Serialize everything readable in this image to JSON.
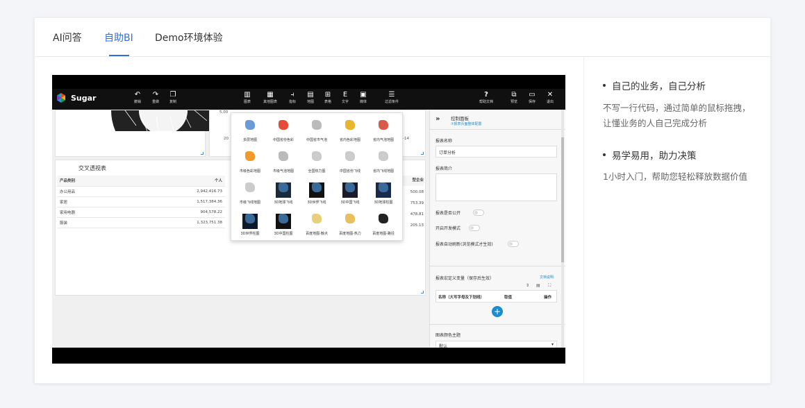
{
  "tabs": [
    {
      "label": "AI问答"
    },
    {
      "label": "自助BI"
    },
    {
      "label": "Demo环境体验"
    }
  ],
  "active_tab": 1,
  "side": {
    "items": [
      {
        "title": "自己的业务，自己分析",
        "desc_line1": "不写一行代码，通过简单的鼠标拖拽，",
        "desc_line2": "让懂业务的人自己完成分析"
      },
      {
        "title": "易学易用，助力决策",
        "desc_line1": "1小时入门，帮助您轻松释放数据价值",
        "desc_line2": ""
      }
    ]
  },
  "video": {
    "app_name": "Sugar",
    "toolbar_left": [
      {
        "icon": "undo-icon",
        "label": "撤销"
      },
      {
        "icon": "redo-icon",
        "label": "重做"
      },
      {
        "icon": "copy-icon",
        "label": "复制"
      }
    ],
    "toolbar_mid": [
      {
        "icon": "chart-icon",
        "label": "图表"
      },
      {
        "icon": "grid-icon",
        "label": "其他图表"
      },
      {
        "icon": "metric-icon",
        "label": "指标"
      },
      {
        "icon": "map-icon",
        "label": "地图"
      },
      {
        "icon": "table-icon",
        "label": "表格"
      },
      {
        "icon": "text-icon",
        "label": "文字"
      },
      {
        "icon": "image-icon",
        "label": "媒体"
      },
      {
        "icon": "filter-icon",
        "label": "过滤条件"
      }
    ],
    "toolbar_right": [
      {
        "icon": "help-icon",
        "label": "帮助文档"
      },
      {
        "icon": "preview-icon",
        "label": "预览"
      },
      {
        "icon": "save-icon",
        "label": "保存"
      },
      {
        "icon": "exit-icon",
        "label": "退出"
      }
    ],
    "top_text_a": "5,00",
    "top_text_b": "20",
    "top_text_c": "20-02-14",
    "pivot": {
      "title": "交叉透视表",
      "headers": [
        "产品类别",
        "个人",
        "型企业"
      ],
      "rows": [
        {
          "cat": "办公用品",
          "val": "2,942,416.73",
          "right": "500.08"
        },
        {
          "cat": "家居",
          "val": "1,517,384.36",
          "right": "753.39"
        },
        {
          "cat": "家用电器",
          "val": "904,578.22",
          "right": "478.81"
        },
        {
          "cat": "服装",
          "val": "1,323,751.38",
          "right": "205.13"
        }
      ]
    },
    "map_menu": [
      "多层地图",
      "中国省份色彩",
      "中国省市气泡",
      "省内色彩地图",
      "省内气泡地图",
      "市级色彩地图",
      "市级气泡地图",
      "全国热力图",
      "中国省份飞线",
      "省内飞线地图",
      "市级飞线地图",
      "3D地球飞线",
      "3D世界飞线",
      "3D中国飞线",
      "3D地球柱图",
      "3D世界柱图",
      "3D中国柱图",
      "百度地图-散点",
      "百度地图-热力",
      "百度地图-路径"
    ],
    "control": {
      "title": "控制面板",
      "subtitle": "⑦报表页面整体配置",
      "name_label": "报表名称",
      "name_value": "订单分析",
      "intro_label": "报表简介",
      "public_label": "报表是否公开",
      "dev_label": "开启开发模式",
      "refresh_label": "报表自动刷新(浏览模式才生效)",
      "var_label": "报表宏定义变量（保存后生效）",
      "doc_link": "文档说明",
      "col_name": "名称（大写字母及下划线）",
      "col_value": "取值",
      "col_op": "操作",
      "theme_label": "图表颜色主题",
      "theme_value": "默认"
    }
  },
  "colors": {
    "accent": "#2f6fe4",
    "toolbar_bg": "#101010",
    "link": "#1a8ccf"
  }
}
